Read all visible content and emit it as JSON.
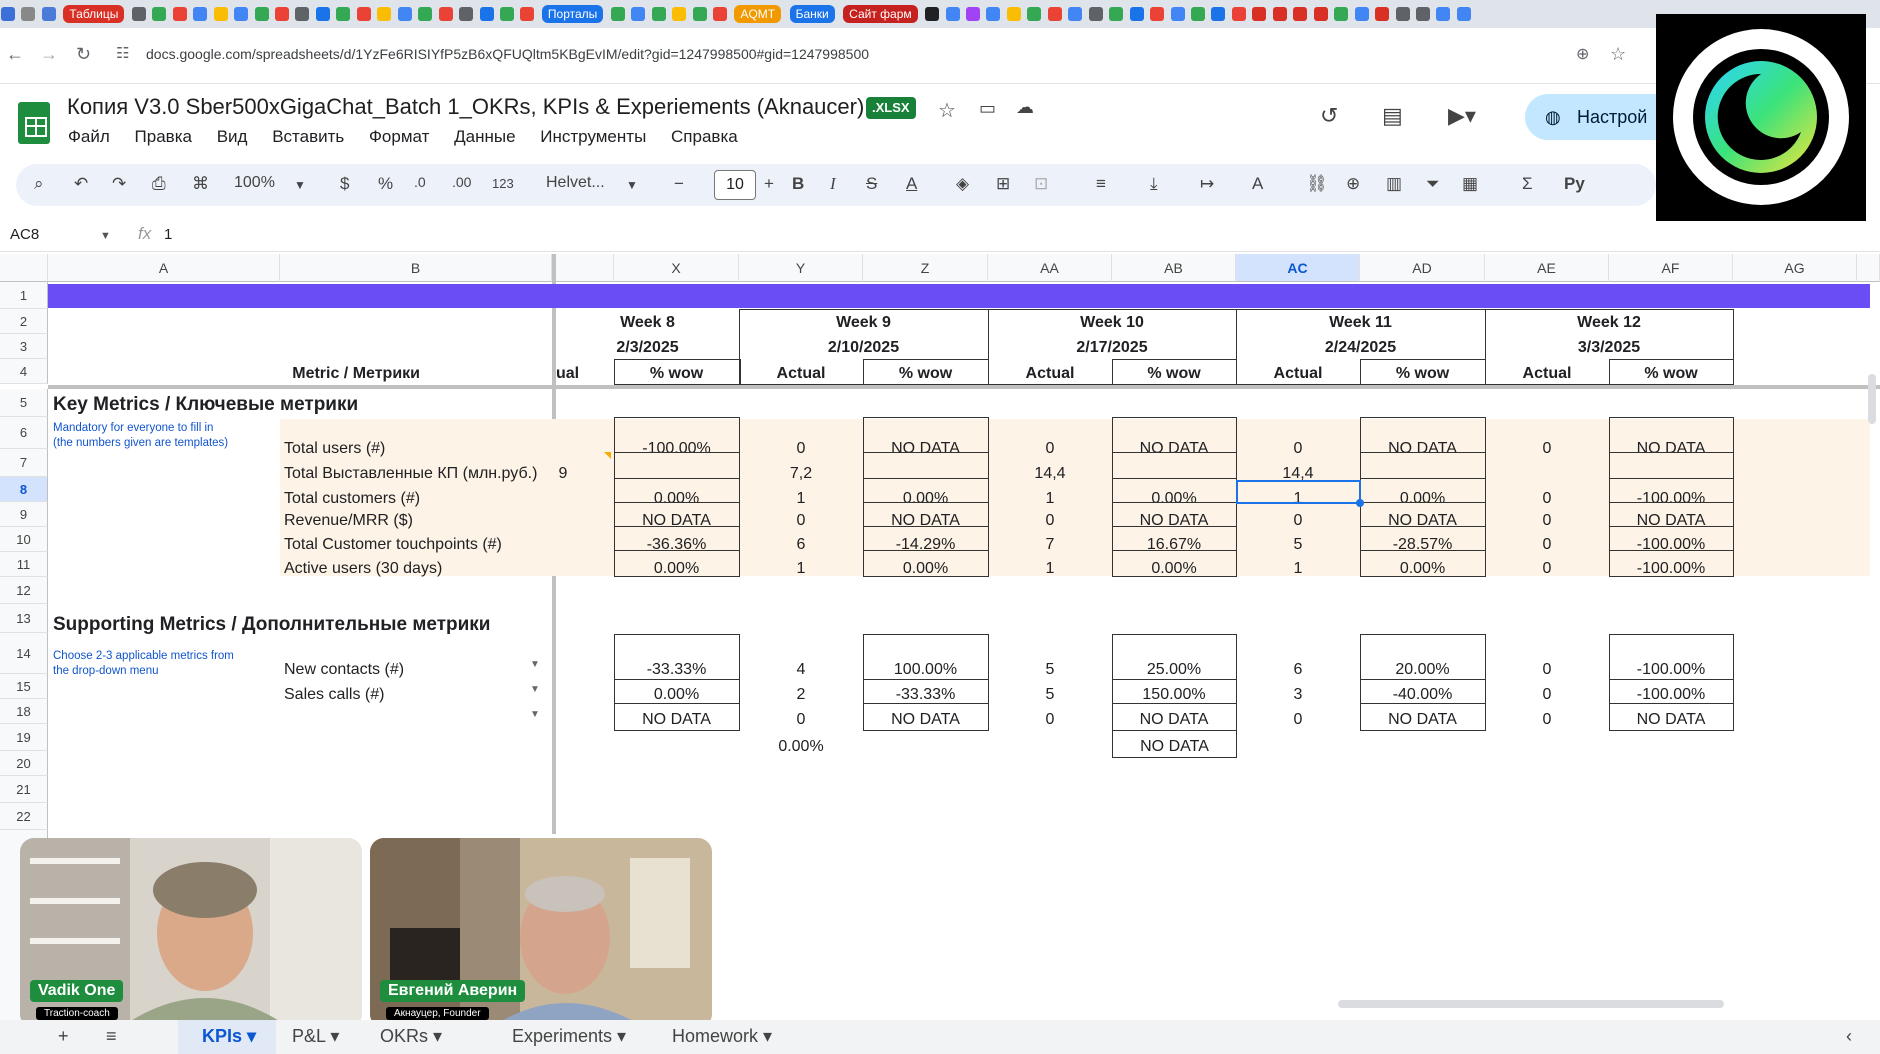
{
  "browser": {
    "tabs": [
      "Таблицы",
      "Порталы",
      "AQMT",
      "Банки",
      "Сайт фарм"
    ],
    "url": "docs.google.com/spreadsheets/d/1YzFe6RISIYfP5zB6xQFUQltm5KBgEvIM/edit?gid=1247998500#gid=1247998500"
  },
  "document": {
    "title": "Копия V3.0 Sber500xGigaChat_Batch 1_OKRs, KPIs & Experiements (Aknaucer)",
    "badge": ".XLSX",
    "share_label": "Настрой",
    "menu": [
      "Файл",
      "Правка",
      "Вид",
      "Вставить",
      "Формат",
      "Данные",
      "Инструменты",
      "Справка"
    ]
  },
  "toolbar": {
    "zoom": "100%",
    "currency": "$",
    "percent": "%",
    "dec_dec": ".0",
    "dec_inc": ".00",
    "format": "123",
    "font": "Helvet...",
    "font_size": "10",
    "bold": "B",
    "italic": "I",
    "script": "Ру"
  },
  "formula_bar": {
    "name_box": "AC8",
    "fx": "fx",
    "value": "1"
  },
  "grid": {
    "columns": [
      "A",
      "B",
      "X",
      "Y",
      "Z",
      "AA",
      "AB",
      "AC",
      "AD",
      "AE",
      "AF",
      "AG"
    ],
    "rows": [
      "1",
      "2",
      "3",
      "4",
      "5",
      "6",
      "7",
      "8",
      "9",
      "10",
      "11",
      "12",
      "13",
      "14",
      "15",
      "18",
      "19",
      "20",
      "21",
      "22"
    ],
    "weeks": [
      {
        "label": "Week 8",
        "date": "2/3/2025"
      },
      {
        "label": "Week 9",
        "date": "2/10/2025"
      },
      {
        "label": "Week 10",
        "date": "2/17/2025"
      },
      {
        "label": "Week 11",
        "date": "2/24/2025"
      },
      {
        "label": "Week 12",
        "date": "3/3/2025"
      }
    ],
    "metric_header": "Metric / Метрики",
    "sub_headers": {
      "actual": "Actual",
      "wow": "% wow",
      "partial": "ual"
    },
    "key_section": "Key Metrics / Ключевые метрики",
    "key_note": [
      "Mandatory for everyone to fill in",
      "(the numbers given are templates)"
    ],
    "key_metrics": [
      {
        "label": "Total users (#)",
        "cut": "",
        "values": [
          "-100.00%",
          "0",
          "NO DATA",
          "0",
          "NO DATA",
          "0",
          "NO DATA",
          "0",
          "NO DATA"
        ]
      },
      {
        "label": "Total Выставленные КП (млн.руб.)",
        "cut": "9",
        "values": [
          "",
          "7,2",
          "",
          "14,4",
          "",
          "14,4",
          "",
          "",
          ""
        ]
      },
      {
        "label": "Total customers (#)",
        "cut": "",
        "values": [
          "0.00%",
          "1",
          "0.00%",
          "1",
          "0.00%",
          "1",
          "0.00%",
          "0",
          "-100.00%"
        ]
      },
      {
        "label": "Revenue/MRR ($)",
        "cut": "",
        "values": [
          "NO DATA",
          "0",
          "NO DATA",
          "0",
          "NO DATA",
          "0",
          "NO DATA",
          "0",
          "NO DATA"
        ]
      },
      {
        "label": "Total Customer touchpoints (#)",
        "cut": "",
        "values": [
          "-36.36%",
          "6",
          "-14.29%",
          "7",
          "16.67%",
          "5",
          "-28.57%",
          "0",
          "-100.00%"
        ]
      },
      {
        "label": "Active users (30 days)",
        "cut": "",
        "values": [
          "0.00%",
          "1",
          "0.00%",
          "1",
          "0.00%",
          "1",
          "0.00%",
          "0",
          "-100.00%"
        ]
      }
    ],
    "support_section": "Supporting Metrics / Дополнительные метрики",
    "support_note": [
      "Choose 2-3 applicable metrics from",
      "the drop-down menu"
    ],
    "support_metrics": [
      {
        "label": "New contacts (#)",
        "values": [
          "-33.33%",
          "4",
          "100.00%",
          "5",
          "25.00%",
          "6",
          "20.00%",
          "0",
          "-100.00%"
        ]
      },
      {
        "label": "Sales calls (#)",
        "values": [
          "0.00%",
          "2",
          "-33.33%",
          "5",
          "150.00%",
          "3",
          "-40.00%",
          "0",
          "-100.00%"
        ]
      },
      {
        "label": "",
        "values": [
          "NO DATA",
          "0",
          "NO DATA",
          "0",
          "NO DATA",
          "0",
          "NO DATA",
          "0",
          "NO DATA"
        ]
      }
    ],
    "row19": {
      "y": "0.00%",
      "ab": "NO DATA"
    }
  },
  "video": [
    {
      "name": "Vadik One",
      "role": "Traction-coach"
    },
    {
      "name": "Евгений Аверин",
      "role": "Акнауцер, Founder"
    }
  ],
  "sheet_tabs": [
    "KPIs",
    "P&L",
    "OKRs",
    "Experiments",
    "Homework"
  ],
  "colors": {
    "purple_band": "#6b4df5",
    "key_bg": "#fdf3e6",
    "accent": "#0b57d0"
  }
}
